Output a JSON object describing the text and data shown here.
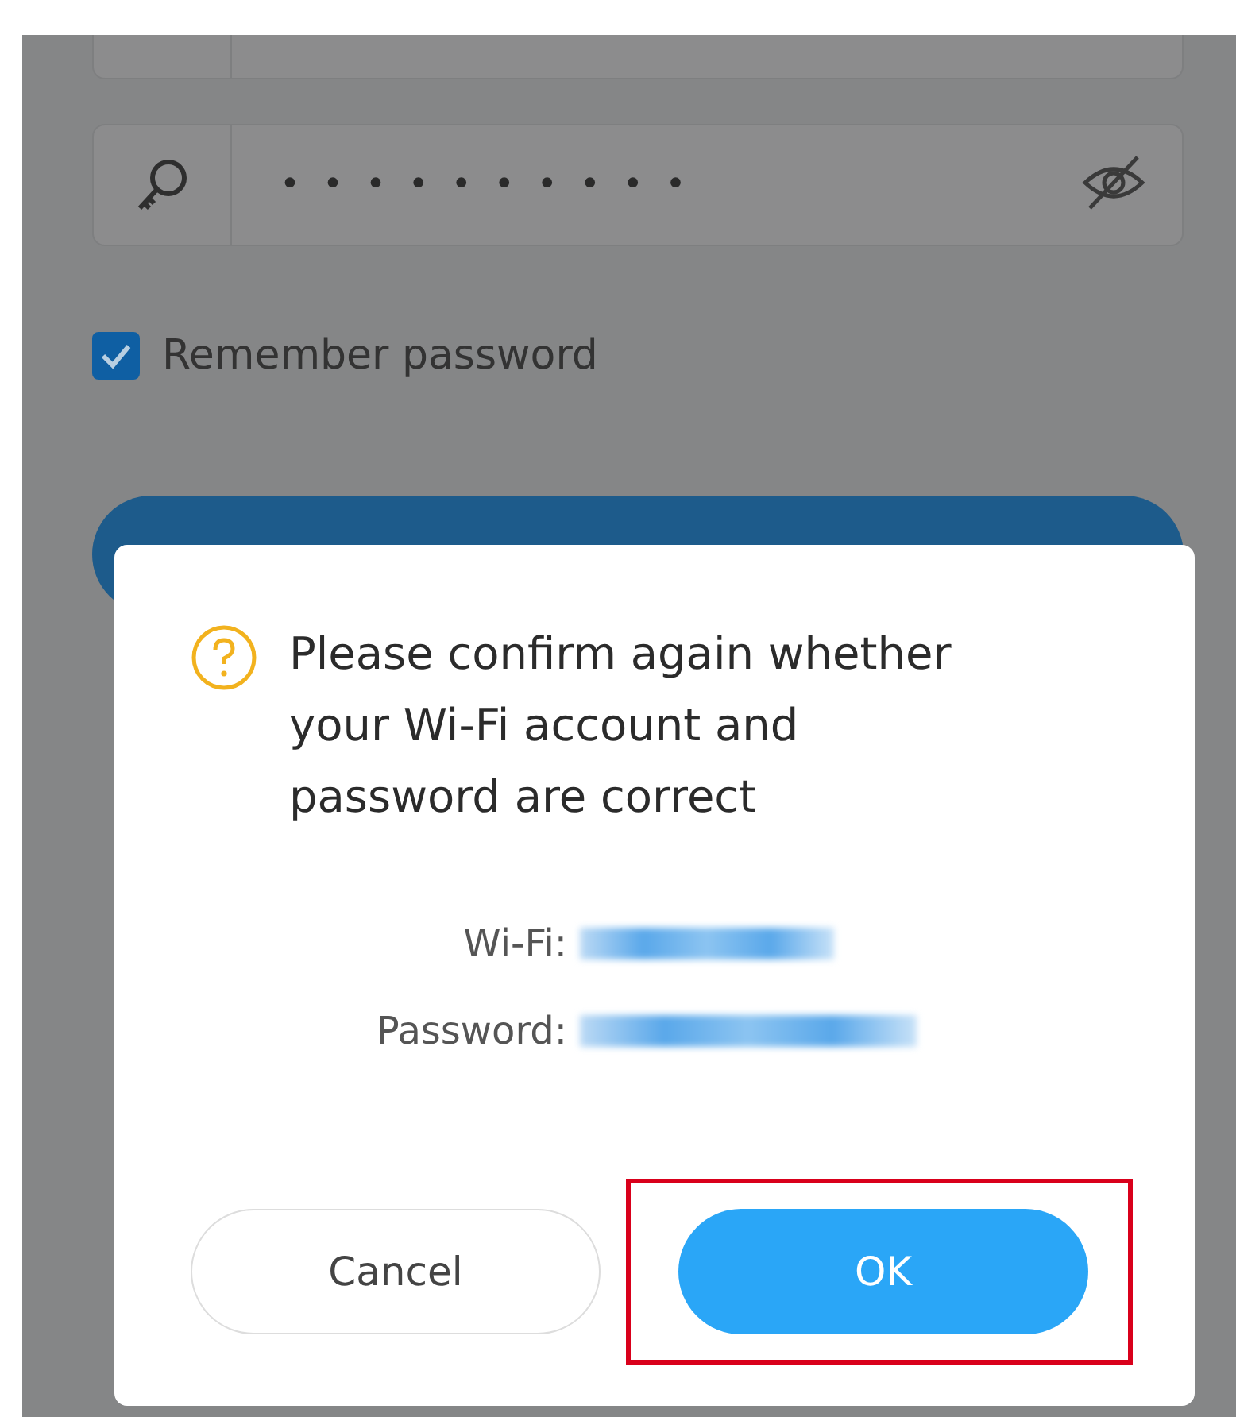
{
  "password_field": {
    "value": "••••••••••",
    "hidden": true
  },
  "remember": {
    "label": "Remember password",
    "checked": true
  },
  "dialog": {
    "message": "Please confirm again whether your Wi-Fi account and password are correct",
    "details": [
      {
        "label": "Wi-Fi:"
      },
      {
        "label": "Password:"
      }
    ],
    "buttons": [
      {
        "label": "Cancel",
        "kind": "secondary",
        "highlighted": false
      },
      {
        "label": "OK",
        "kind": "primary",
        "highlighted": true
      }
    ]
  }
}
